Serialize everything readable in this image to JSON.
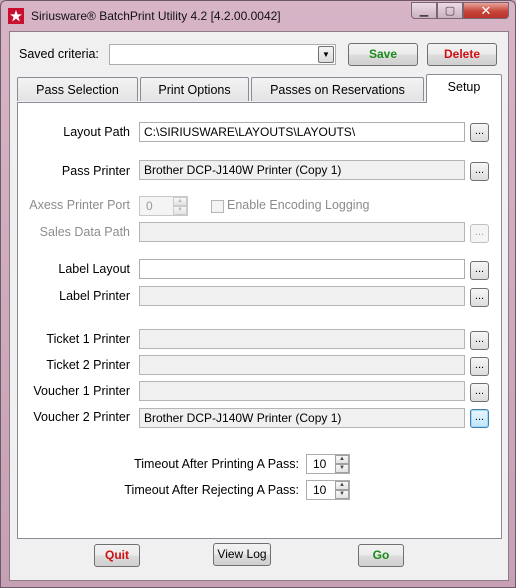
{
  "window": {
    "title": "Siriusware® BatchPrint Utility  4.2  [4.2.00.0042]",
    "min_glyph": "▁",
    "max_glyph": "▢",
    "close_glyph": "✕"
  },
  "criteria": {
    "label": "Saved criteria:",
    "value": "",
    "dropdown_glyph": "▼",
    "save_label": "Save",
    "delete_label": "Delete"
  },
  "tabs": [
    {
      "label": "Pass Selection"
    },
    {
      "label": "Print Options"
    },
    {
      "label": "Passes on Reservations"
    },
    {
      "label": "Setup"
    }
  ],
  "setup": {
    "browse_glyph": "...",
    "layout_path": {
      "label": "Layout Path",
      "value": "C:\\SIRIUSWARE\\LAYOUTS\\LAYOUTS\\"
    },
    "pass_printer": {
      "label": "Pass Printer",
      "value": "Brother DCP-J140W Printer (Copy 1)"
    },
    "axess_port": {
      "label": "Axess Printer Port",
      "value": "0"
    },
    "encoding_logging": {
      "label": "Enable Encoding Logging",
      "checked": false
    },
    "sales_data_path": {
      "label": "Sales Data Path",
      "value": ""
    },
    "label_layout": {
      "label": "Label Layout",
      "value": ""
    },
    "label_printer": {
      "label": "Label Printer",
      "value": ""
    },
    "ticket1_printer": {
      "label": "Ticket 1 Printer",
      "value": ""
    },
    "ticket2_printer": {
      "label": "Ticket 2 Printer",
      "value": ""
    },
    "voucher1_printer": {
      "label": "Voucher 1 Printer",
      "value": ""
    },
    "voucher2_printer": {
      "label": "Voucher 2 Printer",
      "value": "Brother DCP-J140W Printer (Copy 1)"
    },
    "timeout_printing": {
      "label": "Timeout After Printing A Pass:",
      "value": "10"
    },
    "timeout_rejecting": {
      "label": "Timeout After Rejecting A Pass:",
      "value": "10"
    }
  },
  "footer": {
    "quit_label": "Quit",
    "view_log_label": "View Log",
    "go_label": "Go"
  },
  "colors": {
    "save_text": "#1a8a1a",
    "delete_text": "#d01010",
    "quit_text": "#d01010",
    "go_text": "#1a8a1a"
  }
}
